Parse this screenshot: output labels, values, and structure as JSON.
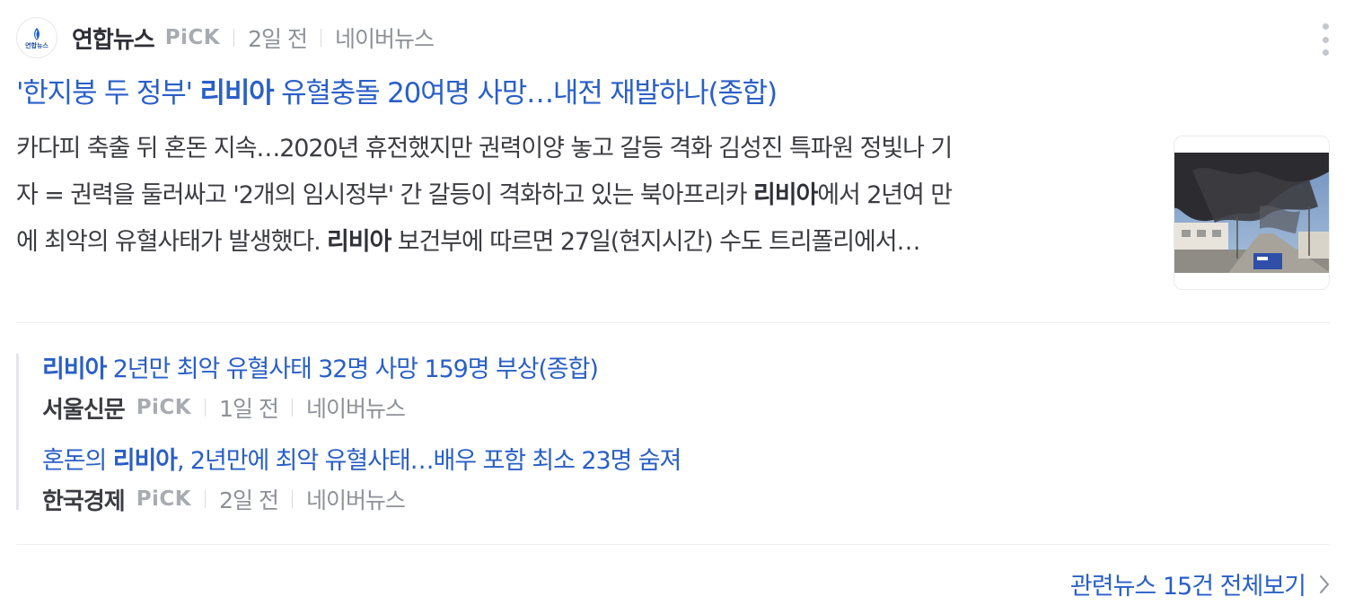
{
  "main": {
    "press": "연합뉴스",
    "logo_text": "연합뉴스",
    "pick": "PiCK",
    "time": "2일 전",
    "platform": "네이버뉴스",
    "title_before": "'한지붕 두 정부' ",
    "title_keyword": "리비아",
    "title_after": " 유혈충돌 20여명 사망…내전 재발하나(종합)",
    "desc_line1": "카다피 축출 뒤 혼돈 지속…2020년 휴전했지만 권력이양 놓고 갈등 격화 김성진 특파원 정빛나 기",
    "desc_line2_before": "자 = 권력을 둘러싸고 '2개의 임시정부' 간 갈등이 격화하고 있는 북아프리카 ",
    "desc_line2_keyword": "리비아",
    "desc_line2_after": "에서 2년여 만",
    "desc_line3_before": "에 최악의 유혈사태가 발생했다. ",
    "desc_line3_keyword": "리비아",
    "desc_line3_after": " 보건부에 따르면 27일(현지시간) 수도 트리폴리에서…",
    "thumbnail_icon": "smoke-over-street-photo"
  },
  "related": [
    {
      "keyword": "리비아",
      "title_rest": " 2년만 최악 유혈사태 32명 사망 159명 부상(종합)",
      "press": "서울신문",
      "pick": "PiCK",
      "time": "1일 전",
      "platform": "네이버뉴스"
    },
    {
      "title_before": "혼돈의 ",
      "keyword": "리비아",
      "title_rest": ", 2년만에 최악 유혈사태…배우 포함 최소 23명 숨져",
      "press": "한국경제",
      "pick": "PiCK",
      "time": "2일 전",
      "platform": "네이버뉴스"
    }
  ],
  "more_link": "관련뉴스 15건 전체보기",
  "colors": {
    "link_blue": "#2a5fc7",
    "body_text": "#3c3d42",
    "meta_gray": "#8d9197",
    "pick_gray": "#a8acb2"
  }
}
